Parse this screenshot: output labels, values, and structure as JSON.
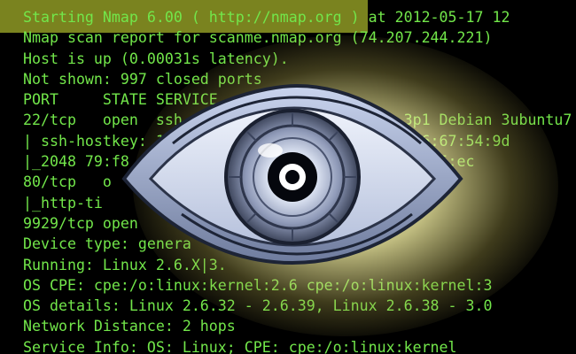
{
  "terminal": {
    "lines": [
      "Starting Nmap 6.00 ( http://nmap.org ) at 2012-05-17 12",
      "Nmap scan report for scanme.nmap.org (74.207.244.221)",
      "Host is up (0.00031s latency).",
      "Not shown: 997 closed ports",
      "PORT     STATE SERVICE    VERSION",
      "22/tcp   open  ssh                         3p1 Debian 3ubuntu7",
      "| ssh-hostkey: 10                       :0a:d6:67:54:9d",
      "|_2048 79:f8                            20:82:85:ec",
      "80/tcp   o                              ((Ubuntu)",
      "|_http-ti",
      "9929/tcp open",
      "Device type: genera",
      "Running: Linux 2.6.X|3.",
      "OS CPE: cpe:/o:linux:kernel:2.6 cpe:/o:linux:kernel:3",
      "OS details: Linux 2.6.32 - 2.6.39, Linux 2.6.38 - 3.0",
      "Network Distance: 2 hops",
      "Service Info: OS: Linux; CPE: cpe:/o:linux:kernel"
    ]
  },
  "colors": {
    "text": "#72e64a",
    "background": "#000000",
    "highlight": "#8f9a25",
    "glow": "#fffad2"
  },
  "overlay": {
    "icon": "eye-icon"
  }
}
